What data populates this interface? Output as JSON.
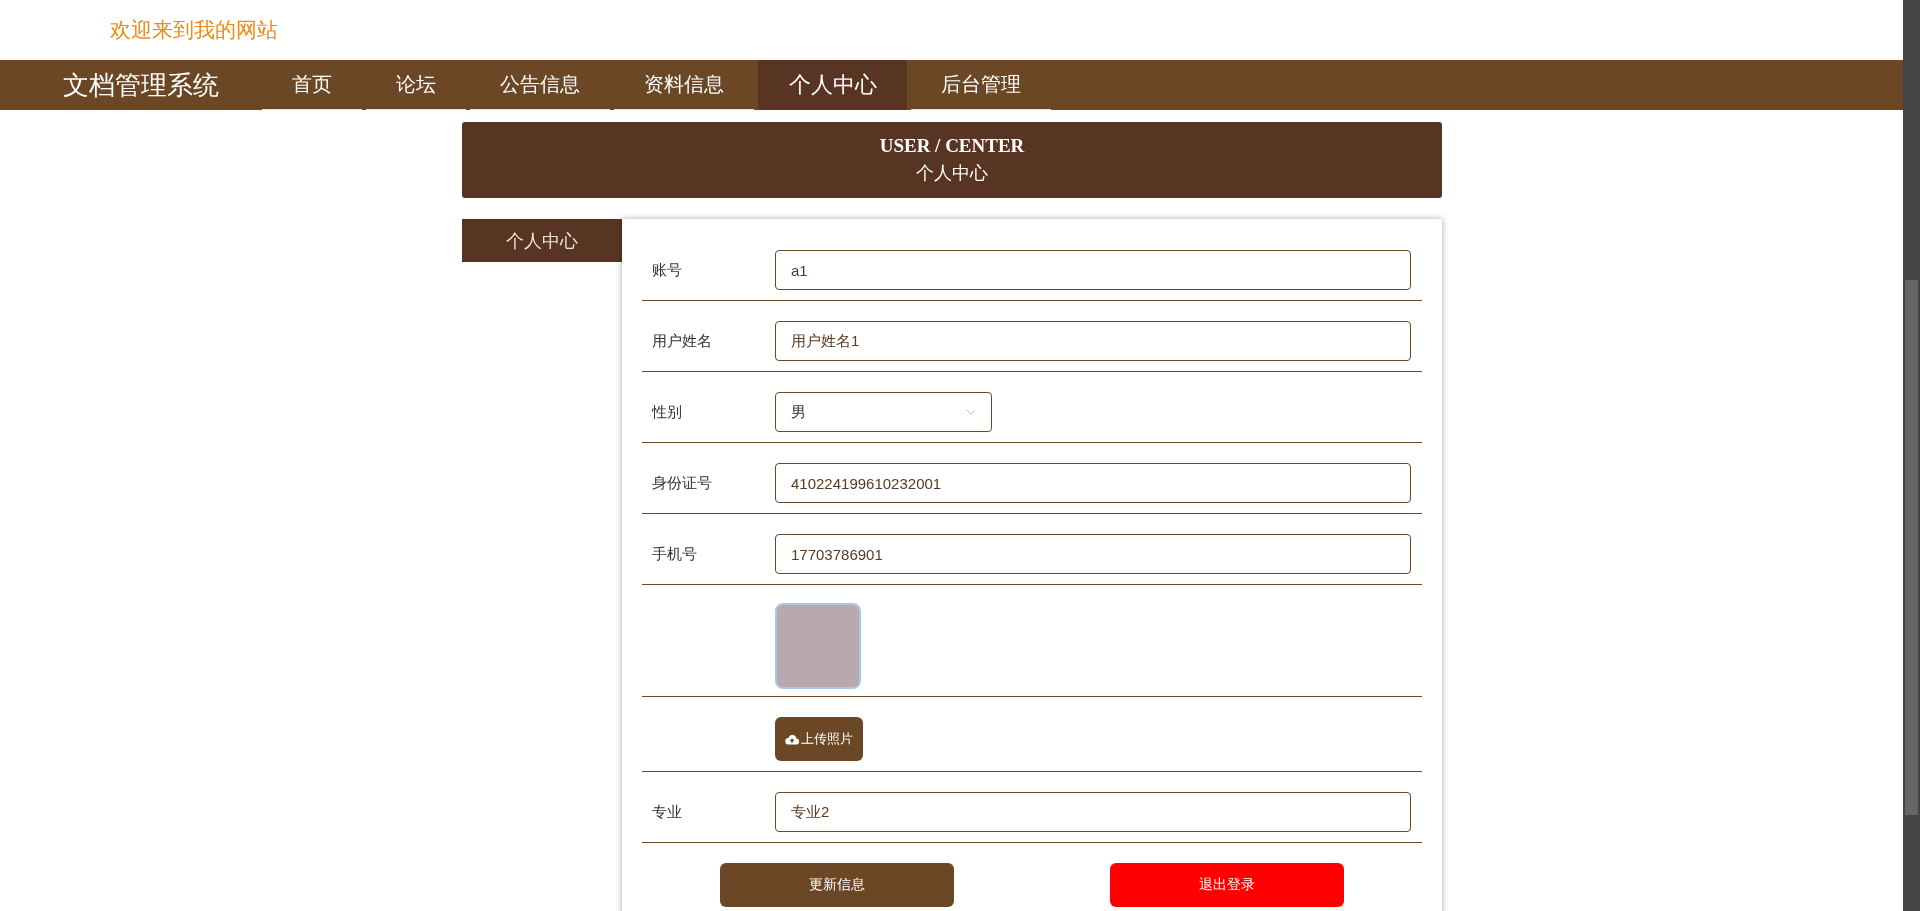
{
  "welcome": "欢迎来到我的网站",
  "nav": {
    "brand": "文档管理系统",
    "items": [
      {
        "label": "首页",
        "selected": false
      },
      {
        "label": "论坛",
        "selected": false
      },
      {
        "label": "公告信息",
        "selected": false
      },
      {
        "label": "资料信息",
        "selected": false
      },
      {
        "label": "个人中心",
        "selected": true
      },
      {
        "label": "后台管理",
        "selected": false
      }
    ]
  },
  "banner": {
    "title": "USER / CENTER",
    "subtitle": "个人中心"
  },
  "sidebar": {
    "items": [
      {
        "label": "个人中心",
        "selected": true
      }
    ]
  },
  "form": {
    "fields": [
      {
        "kind": "text",
        "label": "账号",
        "value": "a1"
      },
      {
        "kind": "text",
        "label": "用户姓名",
        "value": "用户姓名1"
      },
      {
        "kind": "select",
        "label": "性别",
        "value": "男"
      },
      {
        "kind": "text",
        "label": "身份证号",
        "value": "410224199610232001"
      },
      {
        "kind": "text",
        "label": "手机号",
        "value": "17703786901"
      },
      {
        "kind": "photo"
      },
      {
        "kind": "upload",
        "button": "上传照片"
      },
      {
        "kind": "text",
        "label": "专业",
        "value": "专业2"
      }
    ],
    "buttons": [
      {
        "label": "更新信息",
        "kind": "primary"
      },
      {
        "label": "退出登录",
        "kind": "danger"
      }
    ]
  }
}
